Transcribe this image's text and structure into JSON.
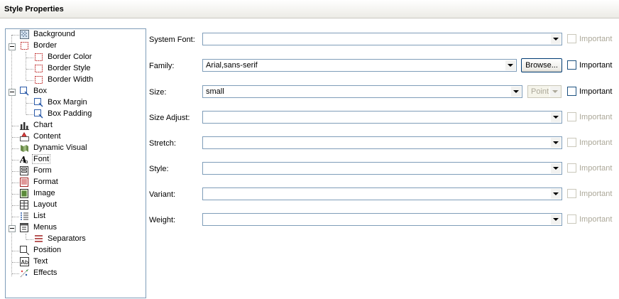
{
  "panel": {
    "title": "Style Properties"
  },
  "tree": {
    "items": [
      {
        "label": "Background",
        "icon": "background-icon",
        "level": 0
      },
      {
        "label": "Border",
        "icon": "border-icon",
        "level": 0,
        "expanded": true
      },
      {
        "label": "Border Color",
        "icon": "border-color-icon",
        "level": 1
      },
      {
        "label": "Border Style",
        "icon": "border-style-icon",
        "level": 1
      },
      {
        "label": "Border Width",
        "icon": "border-width-icon",
        "level": 1
      },
      {
        "label": "Box",
        "icon": "box-icon",
        "level": 0,
        "expanded": true
      },
      {
        "label": "Box Margin",
        "icon": "box-margin-icon",
        "level": 1
      },
      {
        "label": "Box Padding",
        "icon": "box-padding-icon",
        "level": 1
      },
      {
        "label": "Chart",
        "icon": "chart-icon",
        "level": 0
      },
      {
        "label": "Content",
        "icon": "content-icon",
        "level": 0
      },
      {
        "label": "Dynamic Visual",
        "icon": "dynamic-visual-icon",
        "level": 0
      },
      {
        "label": "Font",
        "icon": "font-icon",
        "level": 0,
        "selected": true
      },
      {
        "label": "Form",
        "icon": "form-icon",
        "level": 0
      },
      {
        "label": "Format",
        "icon": "format-icon",
        "level": 0
      },
      {
        "label": "Image",
        "icon": "image-icon",
        "level": 0
      },
      {
        "label": "Layout",
        "icon": "layout-icon",
        "level": 0
      },
      {
        "label": "List",
        "icon": "list-icon",
        "level": 0
      },
      {
        "label": "Menus",
        "icon": "menus-icon",
        "level": 0,
        "expanded": true
      },
      {
        "label": "Separators",
        "icon": "separators-icon",
        "level": 1
      },
      {
        "label": "Position",
        "icon": "position-icon",
        "level": 0
      },
      {
        "label": "Text",
        "icon": "text-icon",
        "level": 0
      },
      {
        "label": "Effects",
        "icon": "effects-icon",
        "level": 0
      }
    ]
  },
  "form": {
    "system_font": {
      "label": "System Font:",
      "value": "",
      "important": "Important",
      "important_enabled": false
    },
    "family": {
      "label": "Family:",
      "value": "Arial,sans-serif",
      "browse": "Browse...",
      "important": "Important",
      "important_enabled": true
    },
    "size": {
      "label": "Size:",
      "value": "small",
      "unit": "Point",
      "important": "Important",
      "important_enabled": true
    },
    "size_adjust": {
      "label": "Size Adjust:",
      "value": "",
      "important": "Important",
      "important_enabled": false
    },
    "stretch": {
      "label": "Stretch:",
      "value": "",
      "important": "Important",
      "important_enabled": false
    },
    "style": {
      "label": "Style:",
      "value": "",
      "important": "Important",
      "important_enabled": false
    },
    "variant": {
      "label": "Variant:",
      "value": "",
      "important": "Important",
      "important_enabled": false
    },
    "weight": {
      "label": "Weight:",
      "value": "",
      "important": "Important",
      "important_enabled": false
    }
  },
  "colors": {
    "border": "#7f9db9",
    "disabled_text": "#aca899"
  }
}
